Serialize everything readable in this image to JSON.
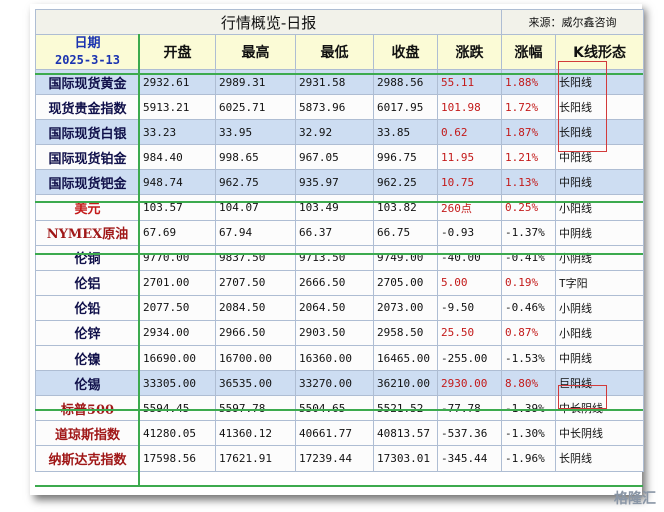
{
  "title": "行情概览-日报",
  "source": "来源：威尔鑫咨询",
  "date_label": "日期",
  "date": "2025-3-13",
  "headers": [
    "开盘",
    "最高",
    "最低",
    "收盘",
    "涨跌",
    "涨幅",
    "K线形态"
  ],
  "rows": [
    {
      "name": "国际现货黄金",
      "open": "2932.61",
      "high": "2989.31",
      "low": "2931.58",
      "close": "2988.56",
      "chg": "55.11",
      "pct": "1.88%",
      "k": "长阳线"
    },
    {
      "name": "现货贵金指数",
      "open": "5913.21",
      "high": "6025.71",
      "low": "5873.96",
      "close": "6017.95",
      "chg": "101.98",
      "pct": "1.72%",
      "k": "长阳线"
    },
    {
      "name": "国际现货白银",
      "open": "33.23",
      "high": "33.95",
      "low": "32.92",
      "close": "33.85",
      "chg": "0.62",
      "pct": "1.87%",
      "k": "长阳线"
    },
    {
      "name": "国际现货铂金",
      "open": "984.40",
      "high": "998.65",
      "low": "967.05",
      "close": "996.75",
      "chg": "11.95",
      "pct": "1.21%",
      "k": "中阳线"
    },
    {
      "name": "国际现货钯金",
      "open": "948.74",
      "high": "962.75",
      "low": "935.97",
      "close": "962.25",
      "chg": "10.75",
      "pct": "1.13%",
      "k": "中阳线"
    },
    {
      "name": "美元",
      "open": "103.57",
      "high": "104.07",
      "low": "103.49",
      "close": "103.82",
      "chg": "260点",
      "pct": "0.25%",
      "k": "小阳线"
    },
    {
      "name": "NYMEX原油",
      "open": "67.69",
      "high": "67.94",
      "low": "66.37",
      "close": "66.75",
      "chg": "-0.93",
      "pct": "-1.37%",
      "k": "中阴线"
    },
    {
      "name": "伦铜",
      "open": "9770.00",
      "high": "9837.50",
      "low": "9713.50",
      "close": "9749.00",
      "chg": "-40.00",
      "pct": "-0.41%",
      "k": "小阴线"
    },
    {
      "name": "伦铝",
      "open": "2701.00",
      "high": "2707.50",
      "low": "2666.50",
      "close": "2705.00",
      "chg": "5.00",
      "pct": "0.19%",
      "k": "T字阳"
    },
    {
      "name": "伦铅",
      "open": "2077.50",
      "high": "2084.50",
      "low": "2064.50",
      "close": "2073.00",
      "chg": "-9.50",
      "pct": "-0.46%",
      "k": "小阴线"
    },
    {
      "name": "伦锌",
      "open": "2934.00",
      "high": "2966.50",
      "low": "2903.50",
      "close": "2958.50",
      "chg": "25.50",
      "pct": "0.87%",
      "k": "小阳线"
    },
    {
      "name": "伦镍",
      "open": "16690.00",
      "high": "16700.00",
      "low": "16360.00",
      "close": "16465.00",
      "chg": "-255.00",
      "pct": "-1.53%",
      "k": "中阴线"
    },
    {
      "name": "伦锡",
      "open": "33305.00",
      "high": "36535.00",
      "low": "33270.00",
      "close": "36210.00",
      "chg": "2930.00",
      "pct": "8.80%",
      "k": "巨阳线"
    },
    {
      "name": "标普500",
      "open": "5594.45",
      "high": "5597.78",
      "low": "5504.65",
      "close": "5521.52",
      "chg": "-77.78",
      "pct": "-1.39%",
      "k": "中长阴线"
    },
    {
      "name": "道琼斯指数",
      "open": "41280.05",
      "high": "41360.12",
      "low": "40661.77",
      "close": "40813.57",
      "chg": "-537.36",
      "pct": "-1.30%",
      "k": "中长阴线"
    },
    {
      "name": "纳斯达克指数",
      "open": "17598.56",
      "high": "17621.91",
      "low": "17239.44",
      "close": "17303.01",
      "chg": "-345.44",
      "pct": "-1.96%",
      "k": "长阴线"
    }
  ],
  "watermark": "格隆汇"
}
